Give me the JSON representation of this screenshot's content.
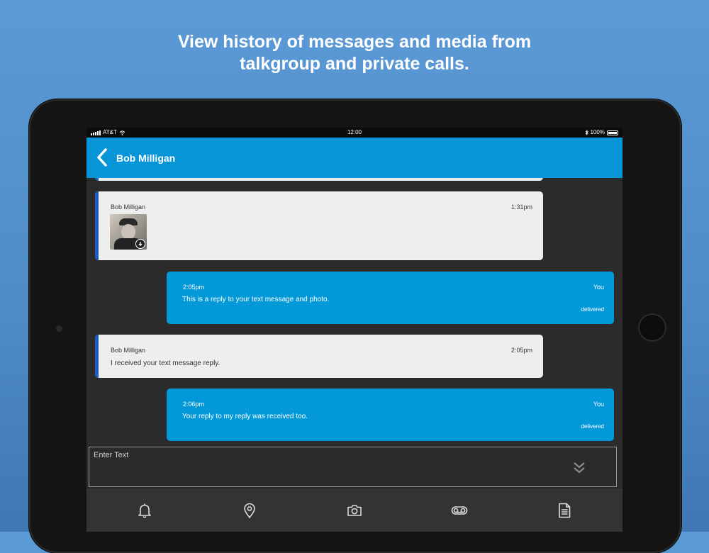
{
  "headline": {
    "line1": "View history of messages and media from",
    "line2": "talkgroup and private calls."
  },
  "status_bar": {
    "carrier": "AT&T",
    "time": "12:00",
    "battery": "100%"
  },
  "nav": {
    "title": "Bob Milligan"
  },
  "messages": [
    {
      "type": "incoming",
      "sender": "Bob Milligan",
      "time": "1:31pm",
      "attachment": "photo"
    },
    {
      "type": "outgoing",
      "time": "2:05pm",
      "sender": "You",
      "text": "This is a reply to your text message and photo.",
      "status": "delivered"
    },
    {
      "type": "incoming",
      "sender": "Bob Milligan",
      "time": "2:05pm",
      "text": "I received your text message reply."
    },
    {
      "type": "outgoing",
      "time": "2:06pm",
      "sender": "You",
      "text": "Your reply to my reply was received too.",
      "status": "delivered"
    }
  ],
  "composer": {
    "placeholder": "Enter Text"
  },
  "tabs": [
    {
      "icon": "bell-icon"
    },
    {
      "icon": "location-pin-icon"
    },
    {
      "icon": "camera-icon"
    },
    {
      "icon": "voicemail-icon"
    },
    {
      "icon": "document-icon"
    }
  ],
  "colors": {
    "background": "#5b9ad6",
    "nav_bar": "#0795d7",
    "outgoing_bubble": "#0399d9",
    "incoming_bubble": "#eeeeee",
    "incoming_accent": "#1a5bc4"
  }
}
